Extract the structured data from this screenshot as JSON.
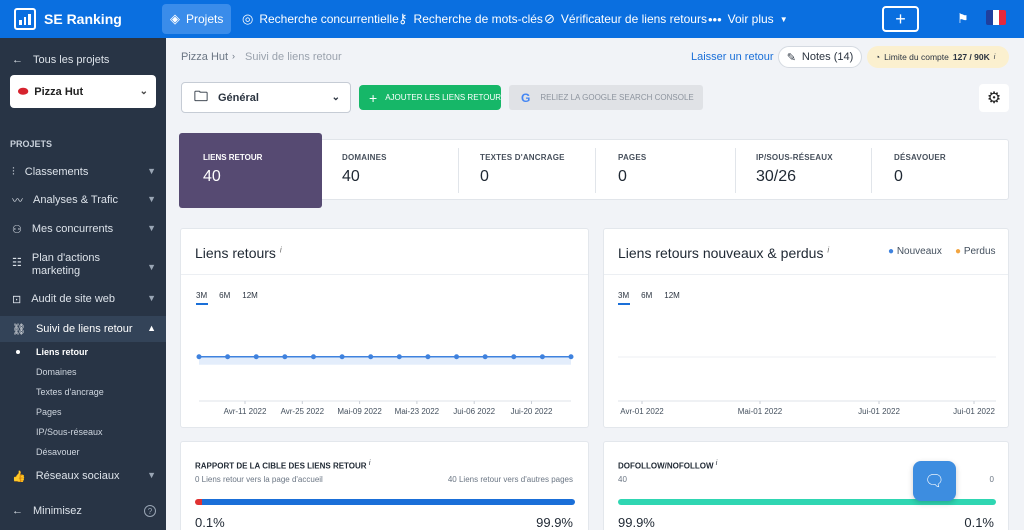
{
  "topbar": {
    "logo": "SE Ranking",
    "nav": [
      {
        "label": "Projets",
        "icon": "layers-icon"
      },
      {
        "label": "Recherche concurrentielle",
        "icon": "target-icon"
      },
      {
        "label": "Recherche de mots-clés",
        "icon": "key-icon"
      },
      {
        "label": "Vérificateur de liens retours",
        "icon": "compass-icon"
      },
      {
        "label": "Voir plus",
        "icon": "more-icon"
      }
    ],
    "plus": "+"
  },
  "sidebar": {
    "all_projects": "Tous les projets",
    "project": "Pizza Hut",
    "section": "PROJETS",
    "items": [
      {
        "label": "Classements"
      },
      {
        "label": "Analyses & Trafic"
      },
      {
        "label": "Mes concurrents"
      },
      {
        "label": "Plan d'actions"
      },
      {
        "label": "marketing"
      },
      {
        "label": "Audit de site web"
      },
      {
        "label": "Suivi de liens retour"
      },
      {
        "label": "Réseaux sociaux"
      }
    ],
    "subitems": [
      "Liens retour",
      "Domaines",
      "Textes d'ancrage",
      "Pages",
      "IP/Sous-réseaux",
      "Désavouer"
    ],
    "minimize": "Minimisez",
    "help": "?"
  },
  "breadcrumb": {
    "root": "Pizza Hut",
    "current": "Suivi de liens retour"
  },
  "header": {
    "feedback": "Laisser un retour",
    "notes": "Notes (14)",
    "limit_label": "Limite du compte",
    "limit_value": "127 / 90K",
    "limit_info": "i"
  },
  "toolbar": {
    "group": "Général",
    "add_button": "AJOUTER LES LIENS RETOUR",
    "gsc_button": "RELIEZ LA GOOGLE SEARCH CONSOLE"
  },
  "stats": [
    {
      "label": "LIENS RETOUR",
      "value": "40"
    },
    {
      "label": "DOMAINES",
      "value": "40"
    },
    {
      "label": "TEXTES D'ANCRAGE",
      "value": "0"
    },
    {
      "label": "PAGES",
      "value": "0"
    },
    {
      "label": "IP/SOUS-RÉSEAUX",
      "value": "30/26"
    },
    {
      "label": "DÉSAVOUER",
      "value": "0"
    }
  ],
  "card1": {
    "title": "Liens retours",
    "info": "i",
    "tabs": [
      "3M",
      "6M",
      "12M"
    ],
    "xticks": [
      "Avr-11 2022",
      "Avr-25 2022",
      "Mai-09 2022",
      "Mai-23 2022",
      "Jui-06 2022",
      "Jui-20 2022"
    ]
  },
  "card2": {
    "title": "Liens retours nouveaux & perdus",
    "info": "i",
    "legend": [
      "Nouveaux",
      "Perdus"
    ],
    "tabs": [
      "3M",
      "6M",
      "12M"
    ],
    "xticks": [
      "Avr-01 2022",
      "Mai-01 2022",
      "Jui-01 2022",
      "Jui-01 2022"
    ]
  },
  "card3": {
    "title": "RAPPORT DE LA CIBLE DES LIENS RETOUR",
    "info": "i",
    "left_note": "0 Liens retour vers la page d'accueil",
    "right_note": "40 Liens retour vers d'autres pages",
    "left_pct": "0.1%",
    "right_pct": "99.9%",
    "share": 0.001
  },
  "card4": {
    "title": "DOFOLLOW/NOFOLLOW",
    "info": "i",
    "left_count": "40",
    "right_count": "0",
    "left_pct": "99.9%",
    "right_pct": "0.1%",
    "share": 0.999
  },
  "colors": {
    "brand": "#0a6fe0",
    "active_stat": "#564a72",
    "green": "#16b768",
    "series": "#3f82de",
    "perdus": "#f2a541",
    "teal": "#2fd6b2"
  },
  "chart_data": [
    {
      "type": "line",
      "title": "Liens retours",
      "x": [
        "Avr-11 2022",
        "Avr-25 2022",
        "Mai-09 2022",
        "Mai-23 2022",
        "Jui-06 2022",
        "Jui-20 2022"
      ],
      "series": [
        {
          "values": [
            40,
            40,
            40,
            40,
            40,
            40,
            40,
            40,
            40,
            40,
            40,
            40,
            40,
            40
          ]
        }
      ]
    },
    {
      "type": "bar",
      "title": "Liens retours nouveaux & perdus",
      "x": [
        "Avr-01 2022",
        "Mai-01 2022",
        "Jui-01 2022",
        "Jui-01 2022"
      ],
      "series": [
        {
          "name": "Nouveaux",
          "values": []
        },
        {
          "name": "Perdus",
          "values": []
        }
      ]
    }
  ]
}
